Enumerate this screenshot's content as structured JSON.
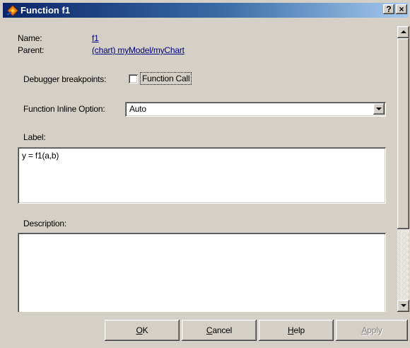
{
  "window": {
    "title": "Function f1",
    "help_button_label": "?",
    "close_button_label": "×"
  },
  "properties": {
    "name_label": "Name:",
    "name_value": "f1",
    "parent_label": "Parent:",
    "parent_value": "(chart) myModel/myChart",
    "debugger_label": "Debugger breakpoints:",
    "function_call_label": "Function Call",
    "function_call_checked": false,
    "inline_option_label": "Function Inline Option:",
    "inline_option_value": "Auto",
    "label_label": "Label:",
    "label_value": "y = f1(a,b)",
    "description_label": "Description:",
    "description_value": ""
  },
  "buttons": {
    "ok_mnemonic": "O",
    "ok_rest": "K",
    "cancel_mnemonic": "C",
    "cancel_rest": "ancel",
    "help_mnemonic": "H",
    "help_rest": "elp",
    "apply_mnemonic": "A",
    "apply_rest": "pply",
    "apply_enabled": false
  },
  "icons": {
    "title_icon": "stateflow-function-icon",
    "combo_arrow": "chevron-down-icon",
    "scroll_up": "scroll-up-arrow-icon",
    "scroll_down": "scroll-down-arrow-icon"
  },
  "colors": {
    "title_bar_start": "#0a246a",
    "title_bar_end": "#a6caf0",
    "dialog_face": "#d4d0c8",
    "link": "#00007f"
  }
}
